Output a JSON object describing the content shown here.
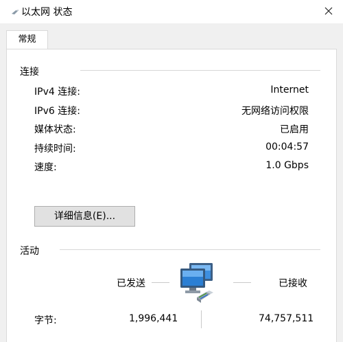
{
  "window": {
    "title": "以太网 状态",
    "close_symbol": "×"
  },
  "tabs": [
    {
      "label": "常规"
    }
  ],
  "connection": {
    "group_title": "连接",
    "rows": [
      {
        "label": "IPv4 连接:",
        "value": "Internet"
      },
      {
        "label": "IPv6 连接:",
        "value": "无网络访问权限"
      },
      {
        "label": "媒体状态:",
        "value": "已启用"
      },
      {
        "label": "持续时间:",
        "value": "00:04:57"
      },
      {
        "label": "速度:",
        "value": "1.0 Gbps"
      }
    ],
    "details_button": "详细信息(E)..."
  },
  "activity": {
    "group_title": "活动",
    "sent_label": "已发送",
    "received_label": "已接收",
    "bytes_label": "字节:",
    "bytes_sent": "1,996,441",
    "bytes_received": "74,757,511",
    "icon": "network-computers-icon"
  },
  "colors": {
    "dialog_bg": "#f0f0f0",
    "panel_bg": "#ffffff",
    "button_bg": "#e1e1e1",
    "monitor_blue": "#2b7fd4"
  }
}
